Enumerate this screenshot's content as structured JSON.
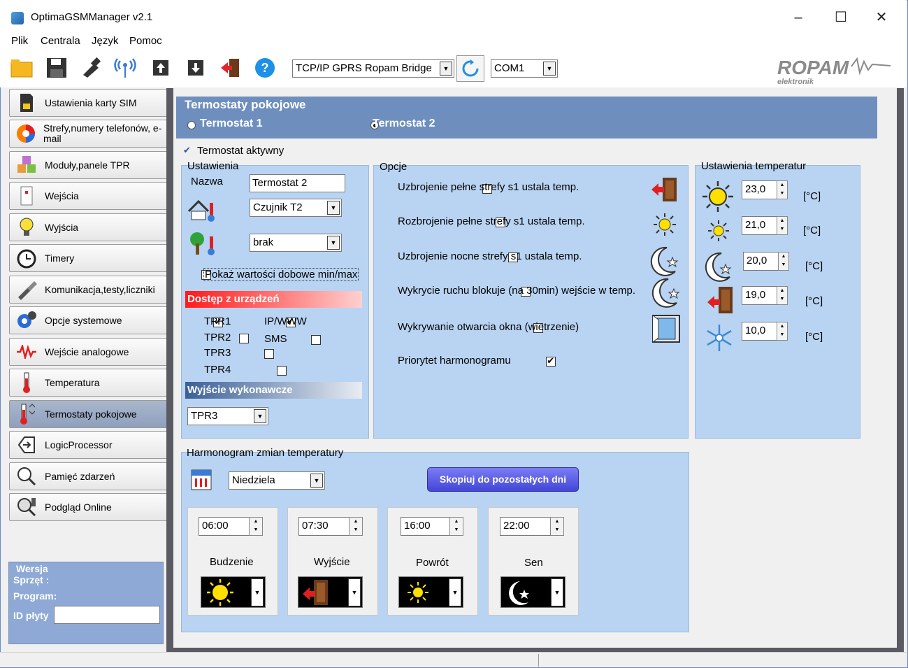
{
  "window": {
    "title": "OptimaGSMManager v2.1"
  },
  "menu": [
    "Plik",
    "Centrala",
    "Język",
    "Pomoc"
  ],
  "toolbar": {
    "connection": "TCP/IP GPRS Ropam Bridge",
    "port": "COM1",
    "logo_text": "ROPAM",
    "logo_sub": "elektronik"
  },
  "sidebar": {
    "items": [
      {
        "label": "Ustawienia karty SIM",
        "icon": "sim-card-icon"
      },
      {
        "label": "Strefy,numery telefonów, e-mail",
        "icon": "zones-icon"
      },
      {
        "label": "Moduły,panele TPR",
        "icon": "modules-icon"
      },
      {
        "label": "Wejścia",
        "icon": "inputs-icon"
      },
      {
        "label": "Wyjścia",
        "icon": "bulb-icon"
      },
      {
        "label": "Timery",
        "icon": "clock-icon"
      },
      {
        "label": "Komunikacja,testy,liczniki",
        "icon": "tools-icon"
      },
      {
        "label": "Opcje systemowe",
        "icon": "gear-icon"
      },
      {
        "label": "Wejście analogowe",
        "icon": "wave-icon"
      },
      {
        "label": "Temperatura",
        "icon": "thermometer-icon"
      },
      {
        "label": "Termostaty pokojowe",
        "icon": "thermostat-icon"
      },
      {
        "label": "LogicProcessor",
        "icon": "logic-icon"
      },
      {
        "label": "Pamięć zdarzeń",
        "icon": "events-icon"
      },
      {
        "label": "Podgląd Online",
        "icon": "online-icon"
      }
    ],
    "active": 10
  },
  "version": {
    "title": "Wersja",
    "hw": "Sprzęt :",
    "program": "Program:",
    "board_id": "ID płyty",
    "board_id_value": ""
  },
  "thermostats": {
    "title": "Termostaty pokojowe",
    "opt1": "Termostat 1",
    "opt2": "Termostat 2",
    "active_label": "Termostat aktywny"
  },
  "settings": {
    "title": "Ustawienia",
    "name_label": "Nazwa",
    "name_value": "Termostat 2",
    "sensor": "Czujnik T2",
    "sensor2": "brak",
    "show_minmax": "Pokaż wartości dobowe min/max",
    "access_title": "Dostęp z urządzeń",
    "tpr1": "TPR1",
    "tpr2": "TPR2",
    "tpr3": "TPR3",
    "tpr4": "TPR4",
    "ipwww": "IP/WWW",
    "sms": "SMS",
    "output_title": "Wyjście wykonawcze",
    "output_value": "TPR3"
  },
  "options": {
    "title": "Opcje",
    "items": [
      {
        "label": "Uzbrojenie pełne strefy s1 ustala temp.",
        "checked": false
      },
      {
        "label": "Rozbrojenie pełne strefy s1 ustala temp.",
        "checked": false
      },
      {
        "label": "Uzbrojenie nocne strefy s1 ustala temp.",
        "checked": false
      },
      {
        "label": "Wykrycie ruchu blokuje (na 30min) wejście w temp.",
        "checked": false
      },
      {
        "label": "Wykrywanie otwarcia okna (wietrzenie)",
        "checked": false
      },
      {
        "label": "Priorytet harmonogramu",
        "checked": true
      }
    ]
  },
  "temps": {
    "title": "Ustawienia temperatur",
    "unit": "[°C]",
    "values": [
      "23,0",
      "21,0",
      "20,0",
      "19,0",
      "10,0"
    ]
  },
  "schedule": {
    "title": "Harmonogram zmian temperatury",
    "day": "Niedziela",
    "copy_btn": "Skopiuj do pozostałych dni",
    "slots": [
      {
        "time": "06:00",
        "label": "Budzenie"
      },
      {
        "time": "07:30",
        "label": "Wyjście"
      },
      {
        "time": "16:00",
        "label": "Powrót"
      },
      {
        "time": "22:00",
        "label": "Sen"
      }
    ]
  },
  "colors": {
    "accent": "#6e8fbe",
    "panel": "#b9d4f2",
    "access_red": "#ff2a2a"
  }
}
